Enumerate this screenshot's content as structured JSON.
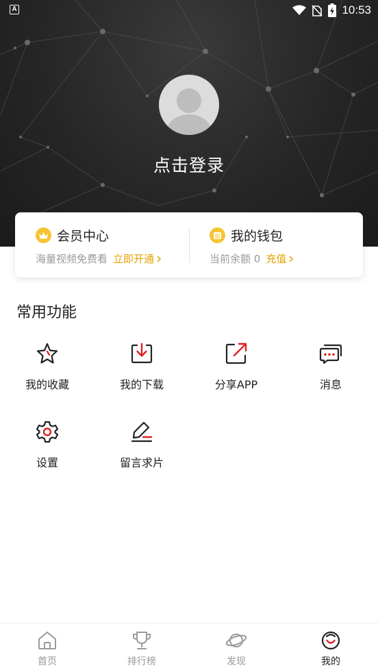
{
  "status_bar": {
    "time": "10:53",
    "indicator": "A"
  },
  "profile": {
    "login_text": "点击登录"
  },
  "membership": {
    "title": "会员中心",
    "subtitle": "海量视频免费看",
    "link": "立即开通",
    "icon": "crown-icon"
  },
  "wallet": {
    "title": "我的钱包",
    "subtitle": "当前余额 0",
    "link": "充值",
    "icon": "wallet-icon"
  },
  "functions": {
    "title": "常用功能",
    "items": [
      {
        "label": "我的收藏",
        "icon": "star-icon"
      },
      {
        "label": "我的下载",
        "icon": "download-icon"
      },
      {
        "label": "分享APP",
        "icon": "share-icon"
      },
      {
        "label": "消息",
        "icon": "message-icon"
      },
      {
        "label": "设置",
        "icon": "gear-icon"
      },
      {
        "label": "留言求片",
        "icon": "edit-icon"
      }
    ]
  },
  "bottom_nav": {
    "items": [
      {
        "label": "首页",
        "icon": "home-icon",
        "active": false
      },
      {
        "label": "排行榜",
        "icon": "trophy-icon",
        "active": false
      },
      {
        "label": "发现",
        "icon": "planet-icon",
        "active": false
      },
      {
        "label": "我的",
        "icon": "profile-face-icon",
        "active": true
      }
    ]
  },
  "colors": {
    "accent_gold": "#e5a400",
    "accent_red": "#e02020",
    "header_dark": "#262626"
  }
}
